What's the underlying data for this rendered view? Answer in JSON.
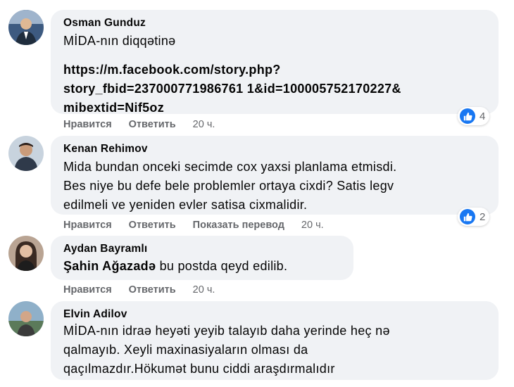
{
  "comments": [
    {
      "author": "Osman Gunduz",
      "line1": "MİDA-nın diqqətinə",
      "link_lines": "https://m.facebook.com/story.php?\nstory_fbid=237000771986761 1&id=100005752170227&\nmibextid=Nif5oz",
      "actions": {
        "like": "Нравится",
        "reply": "Ответить",
        "time": "20 ч."
      },
      "reaction_count": "4"
    },
    {
      "author": "Kenan Rehimov",
      "text": "Mida bundan onceki secimde cox yaxsi planlama etmisdi.\nBes niye bu defe bele problemler ortaya cixdi? Satis legv\nedilmeli ve yeniden evler satisa cixmalidir.",
      "actions": {
        "like": "Нравится",
        "reply": "Ответить",
        "translate": "Показать перевод",
        "time": "20 ч."
      },
      "reaction_count": "2"
    },
    {
      "author": "Aydan Bayramlı",
      "mention": "Şahin Ağazadə",
      "text_after": " bu postda qeyd edilib.",
      "actions": {
        "like": "Нравится",
        "reply": "Ответить",
        "time": "20 ч."
      }
    },
    {
      "author": "Elvin Adilov",
      "text": "MİDA-nın idraə heyəti yeyib talayıb daha yerinde heç nə\nqalmayıb. Xeyli maxinasiyaların olması da\nqaçılmazdır.Hökumət bunu ciddi araşdırmalıdır"
    }
  ],
  "colors": {
    "bubble": "#f0f2f5",
    "like_blue": "#1877f2",
    "meta_gray": "#65676b"
  },
  "icons": [
    "like-icon"
  ]
}
